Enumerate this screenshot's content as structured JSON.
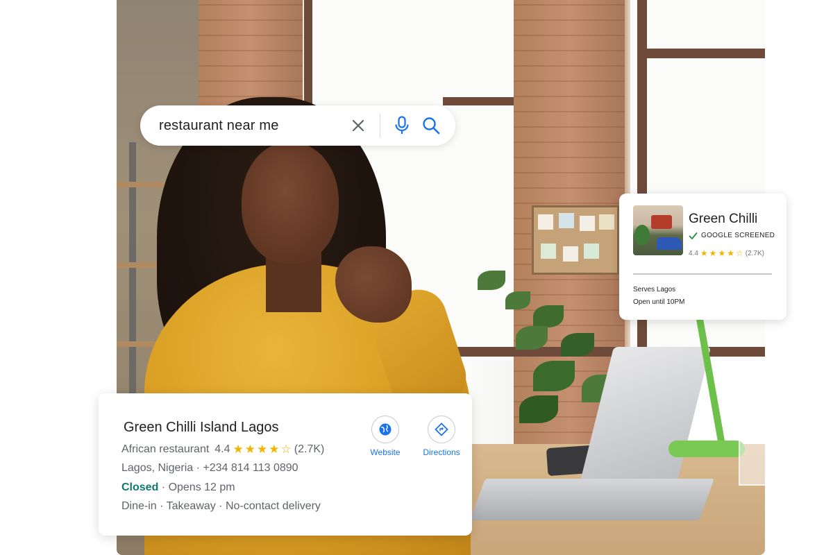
{
  "search": {
    "query": "restaurant near me"
  },
  "place_card": {
    "name": "Green Chilli",
    "verified_label": "GOOGLE SCREENED",
    "rating": "4.4",
    "stars": 4.5,
    "review_count": "(2.7K)",
    "serves": "Serves Lagos",
    "hours": "Open until 10PM"
  },
  "listing": {
    "name": "Green Chilli Island Lagos",
    "category": "African restaurant",
    "rating": "4.4",
    "stars": 4.5,
    "review_count": "(2.7K)",
    "address_phone": "Lagos, Nigeria · +234 814 113 0890",
    "status": "Closed",
    "opens": " · Opens 12 pm",
    "services": "Dine-in · Takeaway · No-contact delivery",
    "actions": {
      "website_label": "Website",
      "directions_label": "Directions"
    }
  },
  "colors": {
    "accent_blue": "#1a73e8",
    "closed_green": "#0d7a6f",
    "star_gold": "#f3b400",
    "check_green": "#1e8e3e"
  }
}
